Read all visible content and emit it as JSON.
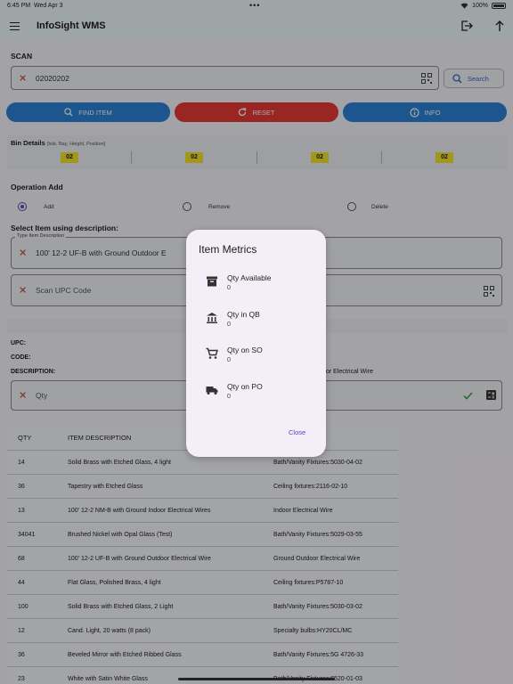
{
  "status_bar": {
    "time": "6:45 PM",
    "date": "Wed Apr 3",
    "battery": "100%"
  },
  "app": {
    "title": "InfoSight WMS"
  },
  "scan": {
    "label": "SCAN",
    "value": "02020202",
    "search_label": "Search"
  },
  "actions": {
    "find_item": "FIND ITEM",
    "reset": "RESET",
    "info": "INFO"
  },
  "bin": {
    "title": "Bin Details",
    "subtitle": "[Isle, Bay, Height, Position]",
    "values": [
      "02",
      "02",
      "02",
      "02"
    ]
  },
  "operation": {
    "label": "Operation Add",
    "options": [
      "Add",
      "Remove",
      "Delete"
    ],
    "selected": "Add"
  },
  "select_item": {
    "label": "Select Item using description:",
    "field_label": "Type Item Description",
    "field_value": "100' 12-2 UF-B with Ground Outdoor E",
    "upc_placeholder": "Scan UPC Code"
  },
  "item_info": {
    "upc_label": "UPC:",
    "code_label": "CODE:",
    "description_label": "DESCRIPTION:",
    "description_value": "or Electrical Wire",
    "qty_placeholder": "Qty"
  },
  "table": {
    "headers": [
      "QTY",
      "ITEM DESCRIPTION"
    ],
    "rows": [
      {
        "qty": "14",
        "desc": "Solid Brass with Etched Glass, 4 light",
        "cat": "Bath/Vanity Fixtures:5030-04-02"
      },
      {
        "qty": "36",
        "desc": "Tapestry with Etched Glass",
        "cat": "Ceiling fixtures:2116-02-10"
      },
      {
        "qty": "13",
        "desc": "100' 12-2 NM-B with Ground Indoor Electrical Wires",
        "cat": "Indoor Electrical Wire"
      },
      {
        "qty": "34041",
        "desc": "Brushed Nickel with Opal Glass (Test)",
        "cat": "Bath/Vanity Fixtures:5029-03-55"
      },
      {
        "qty": "68",
        "desc": "100' 12-2 UF-B with Ground Outdoor Electrical Wire",
        "cat": "Ground Outdoor Electrical Wire"
      },
      {
        "qty": "44",
        "desc": "Flat Glass, Polished Brass, 4 light",
        "cat": "Ceiling fixtures:P5787-10"
      },
      {
        "qty": "100",
        "desc": "Solid Brass with Etched Glass, 2 Light",
        "cat": "Bath/Vanity Fixtures:5030-03-02"
      },
      {
        "qty": "12",
        "desc": "Cand. Light, 20 watts (8 pack)",
        "cat": "Specialty bulbs:HY20CL/MC"
      },
      {
        "qty": "36",
        "desc": "Beveled Mirror with Etched Ribbed Glass",
        "cat": "Bath/Vanity Fixtures:5G 4726-33"
      },
      {
        "qty": "23",
        "desc": "White with Satin White Glass",
        "cat": "Bath/Vanity Fixtures:6520-01-03"
      }
    ]
  },
  "dialog": {
    "title": "Item Metrics",
    "metrics": [
      {
        "label": "Qty Available",
        "value": "0",
        "icon": "archive-icon"
      },
      {
        "label": "Qty in QB",
        "value": "0",
        "icon": "bank-icon"
      },
      {
        "label": "Qty on SO",
        "value": "0",
        "icon": "cart-icon"
      },
      {
        "label": "Qty on PO",
        "value": "0",
        "icon": "truck-icon"
      }
    ],
    "close_label": "Close"
  },
  "colors": {
    "primary_blue": "#2c7fd6",
    "reset_red": "#e53935",
    "badge_yellow": "#f1e12b",
    "accent_purple": "#5b45b8"
  }
}
